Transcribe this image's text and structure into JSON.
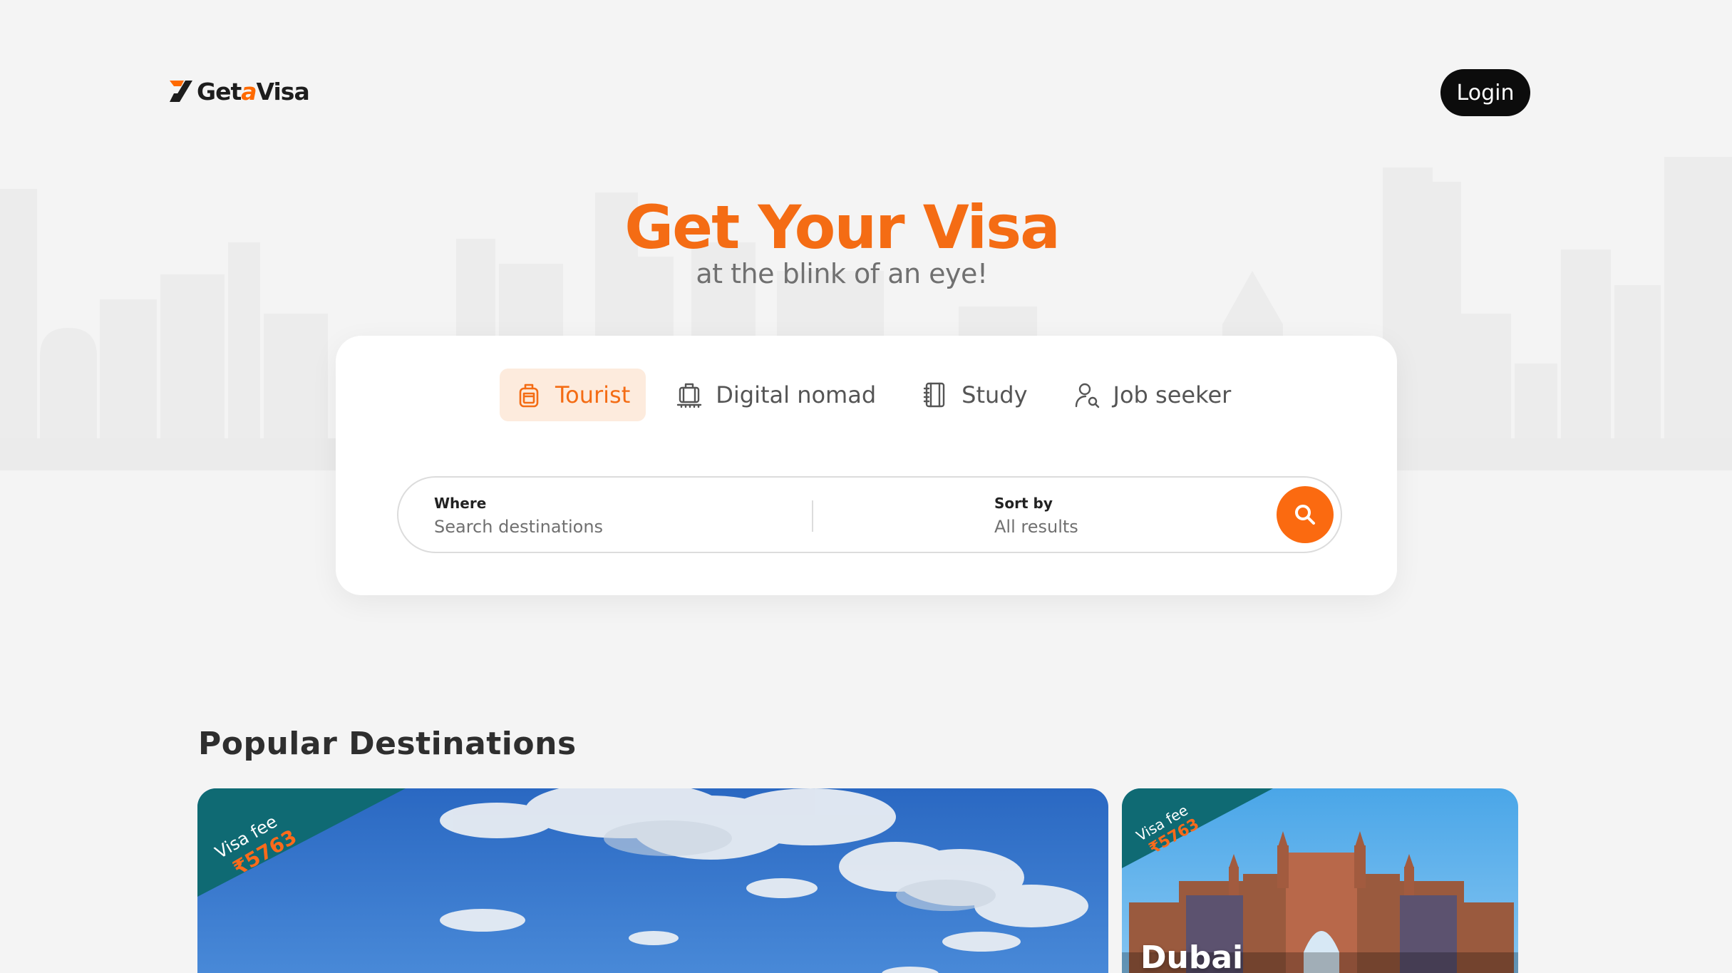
{
  "header": {
    "logo_text_prefix": "Get",
    "logo_text_a": "a",
    "logo_text_suffix": "Visa",
    "login_label": "Login"
  },
  "hero": {
    "title": "Get Your Visa",
    "subtitle": "at the blink of an eye!"
  },
  "tabs": [
    {
      "label": "Tourist",
      "icon": "luggage-icon",
      "active": true
    },
    {
      "label": "Digital nomad",
      "icon": "laptop-bag-icon",
      "active": false
    },
    {
      "label": "Study",
      "icon": "notebook-icon",
      "active": false
    },
    {
      "label": "Job seeker",
      "icon": "user-search-icon",
      "active": false
    }
  ],
  "search": {
    "where_label": "Where",
    "where_placeholder": "Search destinations",
    "sort_label": "Sort by",
    "sort_value": "All results"
  },
  "popular": {
    "title": "Popular Destinations",
    "cards": [
      {
        "name": "",
        "visa_fee_label": "Visa fee",
        "visa_fee": "₹5763"
      },
      {
        "name": "Dubai",
        "visa_fee_label": "Visa fee",
        "visa_fee": "₹5763"
      }
    ]
  },
  "colors": {
    "accent": "#f46c14",
    "ribbon": "#0f6a73",
    "background": "#f4f4f4"
  }
}
